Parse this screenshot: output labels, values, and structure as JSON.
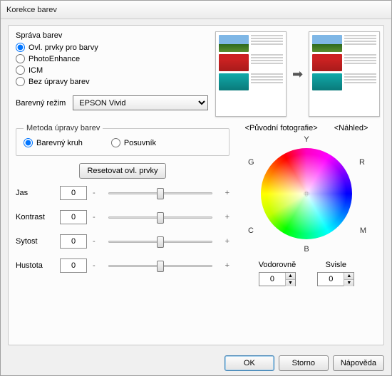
{
  "title": "Korekce barev",
  "mgmt": {
    "legend": "Správa barev",
    "options": [
      "Ovl. prvky pro barvy",
      "PhotoEnhance",
      "ICM",
      "Bez úpravy barev"
    ],
    "selected": 0
  },
  "mode": {
    "label": "Barevný režim",
    "value": "EPSON Vivid"
  },
  "preview": {
    "original": "<Původní fotografie>",
    "result": "<Náhled>"
  },
  "method": {
    "legend": "Metoda úpravy barev",
    "options": [
      "Barevný kruh",
      "Posuvník"
    ],
    "selected": 0
  },
  "reset_label": "Resetovat ovl. prvky",
  "sliders": {
    "brightness": {
      "label": "Jas",
      "value": 0
    },
    "contrast": {
      "label": "Kontrast",
      "value": 0
    },
    "saturation": {
      "label": "Sytost",
      "value": 0
    },
    "density": {
      "label": "Hustota",
      "value": 0
    }
  },
  "wheel": {
    "Y": "Y",
    "G": "G",
    "R": "R",
    "C": "C",
    "M": "M",
    "B": "B"
  },
  "hv": {
    "h": {
      "label": "Vodorovně",
      "value": 0
    },
    "v": {
      "label": "Svisle",
      "value": 0
    }
  },
  "buttons": {
    "ok": "OK",
    "cancel": "Storno",
    "help": "Nápověda"
  }
}
